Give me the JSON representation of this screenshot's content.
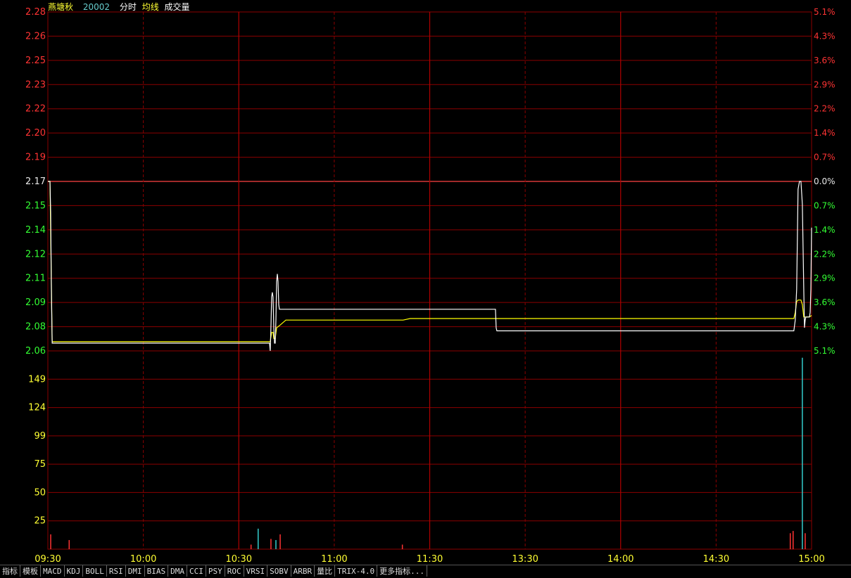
{
  "header": {
    "stock_name": "燕塘秋",
    "stock_code": "20002",
    "mode_label": "分时",
    "avg_label": "均线",
    "volume_label": "成交量"
  },
  "colors": {
    "grid": "#8b0000",
    "up": "#ff3333",
    "down": "#33ff33",
    "flat": "#e8e8e8",
    "price_line": "#ffffff",
    "avg_line": "#ffff00",
    "volume_label": "#ffff33",
    "time_label": "#ffff33",
    "volume_up": "#ff3333",
    "volume_down": "#33cccc"
  },
  "chart_data": {
    "type": "line",
    "prev_close": 2.17,
    "price_axis": [
      "2.28",
      "2.26",
      "2.25",
      "2.23",
      "2.22",
      "2.20",
      "2.19",
      "2.17",
      "2.15",
      "2.14",
      "2.12",
      "2.11",
      "2.09",
      "2.08",
      "2.06"
    ],
    "pct_axis": [
      "5.1%",
      "4.3%",
      "3.6%",
      "2.9%",
      "2.2%",
      "1.4%",
      "0.7%",
      "0.0%",
      "0.7%",
      "1.4%",
      "2.2%",
      "2.9%",
      "3.6%",
      "4.3%",
      "5.1%"
    ],
    "volume_axis": [
      "149",
      "124",
      "99",
      "75",
      "50",
      "25"
    ],
    "volume_max": 174,
    "time_axis": [
      "09:30",
      "10:00",
      "10:30",
      "11:00",
      "11:30",
      "13:30",
      "14:00",
      "14:30",
      "15:00"
    ],
    "total_minutes": 240,
    "price_series": [
      [
        0,
        2.17
      ],
      [
        3,
        2.17
      ],
      [
        4,
        2.15
      ],
      [
        5,
        2.1
      ],
      [
        6,
        2.065
      ],
      [
        312,
        2.065
      ],
      [
        313,
        2.06
      ],
      [
        314,
        2.075
      ],
      [
        315,
        2.095
      ],
      [
        316,
        2.098
      ],
      [
        317,
        2.095
      ],
      [
        318,
        2.075
      ],
      [
        319,
        2.065
      ],
      [
        320,
        2.065
      ],
      [
        321,
        2.08
      ],
      [
        322,
        2.105
      ],
      [
        323,
        2.11
      ],
      [
        324,
        2.105
      ],
      [
        325,
        2.09
      ],
      [
        326,
        2.087
      ],
      [
        340,
        2.087
      ],
      [
        341,
        2.087
      ],
      [
        600,
        2.087
      ],
      [
        630,
        2.087
      ],
      [
        631,
        2.075
      ],
      [
        632,
        2.073
      ],
      [
        1050,
        2.073
      ],
      [
        1052,
        2.08
      ],
      [
        1054,
        2.1
      ],
      [
        1056,
        2.165
      ],
      [
        1058,
        2.17
      ],
      [
        1060,
        2.17
      ],
      [
        1062,
        2.155
      ],
      [
        1064,
        2.1
      ],
      [
        1065,
        2.075
      ],
      [
        1066,
        2.08
      ],
      [
        1067,
        2.082
      ],
      [
        1068,
        2.082
      ],
      [
        1070,
        2.082
      ],
      [
        1072,
        2.082
      ],
      [
        1073,
        2.085
      ],
      [
        1074,
        2.1
      ],
      [
        1075,
        2.14
      ]
    ],
    "avg_series": [
      [
        0,
        2.17
      ],
      [
        3,
        2.17
      ],
      [
        6,
        2.066
      ],
      [
        312,
        2.066
      ],
      [
        313,
        2.066
      ],
      [
        315,
        2.072
      ],
      [
        317,
        2.072
      ],
      [
        318,
        2.068
      ],
      [
        320,
        2.068
      ],
      [
        322,
        2.075
      ],
      [
        325,
        2.076
      ],
      [
        330,
        2.078
      ],
      [
        335,
        2.08
      ],
      [
        340,
        2.08
      ],
      [
        500,
        2.08
      ],
      [
        510,
        2.081
      ],
      [
        640,
        2.081
      ],
      [
        700,
        2.081
      ],
      [
        1050,
        2.081
      ],
      [
        1052,
        2.085
      ],
      [
        1054,
        2.092
      ],
      [
        1056,
        2.093
      ],
      [
        1058,
        2.093
      ],
      [
        1060,
        2.093
      ],
      [
        1062,
        2.09
      ],
      [
        1064,
        2.082
      ],
      [
        1066,
        2.082
      ],
      [
        1072,
        2.082
      ],
      [
        1075,
        2.083
      ]
    ],
    "volume_bars": [
      {
        "t": 4,
        "v": 13,
        "dir": "up"
      },
      {
        "t": 30,
        "v": 8,
        "dir": "up"
      },
      {
        "t": 286,
        "v": 4,
        "dir": "up"
      },
      {
        "t": 296,
        "v": 18,
        "dir": "down"
      },
      {
        "t": 314,
        "v": 9,
        "dir": "up"
      },
      {
        "t": 321,
        "v": 8,
        "dir": "down"
      },
      {
        "t": 327,
        "v": 13,
        "dir": "up"
      },
      {
        "t": 499,
        "v": 4,
        "dir": "up"
      },
      {
        "t": 1045,
        "v": 14,
        "dir": "up"
      },
      {
        "t": 1049,
        "v": 16,
        "dir": "up"
      },
      {
        "t": 1062,
        "v": 168,
        "dir": "down"
      },
      {
        "t": 1066,
        "v": 14,
        "dir": "up"
      }
    ]
  },
  "tabs": [
    "指标",
    "模板",
    "MACD",
    "KDJ",
    "BOLL",
    "RSI",
    "DMI",
    "BIAS",
    "DMA",
    "CCI",
    "PSY",
    "ROC",
    "VRSI",
    "SOBV",
    "ARBR",
    "量比",
    "TRIX-4.0",
    "更多指标..."
  ]
}
